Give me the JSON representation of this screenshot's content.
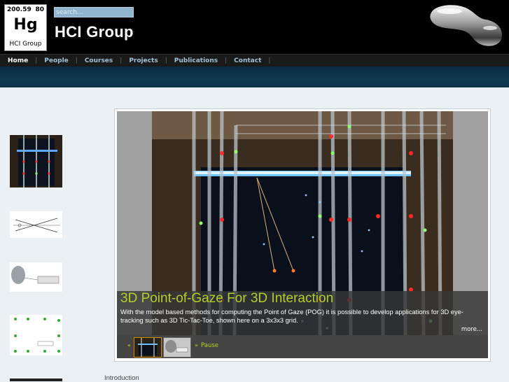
{
  "logo": {
    "mass": "200.59",
    "number": "80",
    "symbol": "Hg",
    "name": "HCI Group"
  },
  "search": {
    "placeholder": "search..."
  },
  "site": {
    "title": "HCI Group"
  },
  "nav": {
    "items": [
      {
        "label": "Home",
        "active": true
      },
      {
        "label": "People"
      },
      {
        "label": "Courses"
      },
      {
        "label": "Projects"
      },
      {
        "label": "Publications"
      },
      {
        "label": "Contact"
      }
    ],
    "separator": "|"
  },
  "slider": {
    "title": "3D Point-of-Gaze For 3D Interaction",
    "text": "With the model based methods for computing the Point of Gaze (POG) it is possible to develop applications for 3D eye-tracking such as 3D Tic-Tac-Toe, shown here on a 3x3x3 grid.",
    "more": "more...",
    "prev": "«",
    "next": "»",
    "pause": "Pause"
  },
  "content": {
    "intro": "Introduction"
  },
  "colors": {
    "accent": "#b4cf2a",
    "nav_link": "#9fc1d8",
    "header_bg": "#000000",
    "page_bg": "#eaf0f3"
  }
}
